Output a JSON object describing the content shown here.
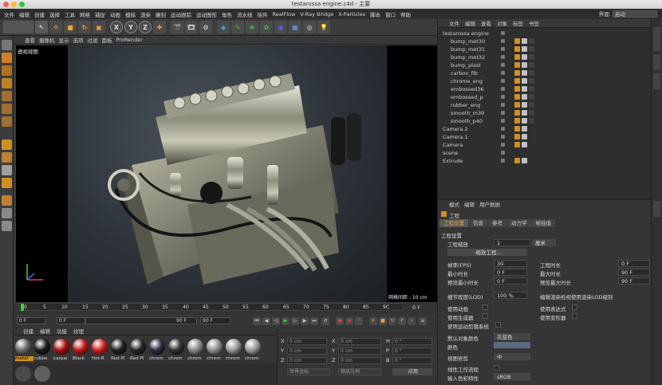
{
  "window": {
    "title": "testarossa engine.c4d - 主要"
  },
  "menu": [
    "文件",
    "编辑",
    "创建",
    "选择",
    "工具",
    "网格",
    "捕捉",
    "动画",
    "模拟",
    "渲染",
    "雕刻",
    "运动跟踪",
    "运动图形",
    "角色",
    "流水线",
    "插件",
    "RealFlow",
    "V-Ray Bridge",
    "X-Particles",
    "脚本",
    "窗口",
    "帮助"
  ],
  "layout": {
    "label": "界面:",
    "value": "启动"
  },
  "toolbar": {
    "x": "X",
    "y": "Y",
    "z": "Z"
  },
  "viewport": {
    "menu": [
      "查看",
      "摄像机",
      "显示",
      "选项",
      "过滤",
      "面板",
      "ProRender"
    ],
    "title": "透视视图",
    "grid_info": "网格间距 : 10 cm"
  },
  "timeline": {
    "ticks": [
      "0",
      "5",
      "10",
      "15",
      "20",
      "25",
      "30",
      "35",
      "40",
      "45",
      "50",
      "55",
      "60",
      "65",
      "70",
      "75",
      "80",
      "85",
      "9C"
    ],
    "end_label": "0 F"
  },
  "transport": {
    "current": "0 F",
    "start": "0 F",
    "end": "90 F",
    "end2": "90 F"
  },
  "materials": {
    "menu": [
      "创建",
      "编辑",
      "功能",
      "纹理"
    ],
    "items": [
      {
        "label": "metal",
        "color": "#6a6a6a"
      },
      {
        "label": "rubbe",
        "color": "#1a1a1a"
      },
      {
        "label": "carpai",
        "color": "#b01010"
      },
      {
        "label": "Black",
        "color": "#c01818"
      },
      {
        "label": "Hot-R",
        "color": "#d02020"
      },
      {
        "label": "Red Pl",
        "color": "#202020"
      },
      {
        "label": "Red Pl",
        "color": "#252525"
      },
      {
        "label": "chrom",
        "color": "#2a2a40"
      },
      {
        "label": "chrom",
        "color": "#303030"
      },
      {
        "label": "chrom",
        "color": "#8a8a8a"
      },
      {
        "label": "chrom",
        "color": "#909090"
      },
      {
        "label": "chrom",
        "color": "#959595"
      },
      {
        "label": "chrom",
        "color": "#9a9a9a"
      }
    ]
  },
  "coords": {
    "x": {
      "label": "X",
      "pos": "0 cm",
      "size": "0 cm",
      "rot_label": "H",
      "rot": "0 °"
    },
    "y": {
      "label": "Y",
      "pos": "0 cm",
      "size": "0 cm",
      "rot_label": "P",
      "rot": "0 °"
    },
    "z": {
      "label": "Z",
      "pos": "0 cm",
      "size": "0 cm",
      "rot_label": "B",
      "rot": "0 °"
    },
    "mode1": "世界坐标",
    "mode2": "缩放比例",
    "apply": "应用"
  },
  "objects": {
    "menu": [
      "文件",
      "编辑",
      "查看",
      "对象",
      "标签",
      "书签"
    ],
    "rows": [
      {
        "name": "testarossa engine",
        "indent": 0
      },
      {
        "name": "bump_met30",
        "indent": 2
      },
      {
        "name": "bump_met31",
        "indent": 2
      },
      {
        "name": "bump_met32",
        "indent": 2
      },
      {
        "name": "bump_plast",
        "indent": 2
      },
      {
        "name": "carbon_fib",
        "indent": 2
      },
      {
        "name": "chrome_eng",
        "indent": 2
      },
      {
        "name": "embossed36",
        "indent": 2
      },
      {
        "name": "embossed_p",
        "indent": 2
      },
      {
        "name": "rubber_eng",
        "indent": 2
      },
      {
        "name": "smooth_m39",
        "indent": 2
      },
      {
        "name": "smooth_p40",
        "indent": 2
      },
      {
        "name": "Camera.2",
        "indent": 0
      },
      {
        "name": "Camera.1",
        "indent": 0
      },
      {
        "name": "Camera",
        "indent": 0
      },
      {
        "name": "scene",
        "indent": 0
      },
      {
        "name": "Extrude",
        "indent": 0
      }
    ]
  },
  "attributes": {
    "menu": [
      "模式",
      "编辑",
      "用户数据"
    ],
    "header": "工程",
    "tabs": [
      "工程设置",
      "信息",
      "参考",
      "动力学",
      "帧插值"
    ],
    "section": "工程设置",
    "scale_label": "工程缩放",
    "scale_value": "1",
    "scale_unit": "厘米",
    "scale_button": "缩放工程...",
    "fps_label": "帧率(FPS)",
    "fps_value": "30",
    "project_time_label": "工程时长",
    "project_time_value": "0 F",
    "min_time_label": "最小时长",
    "min_time_value": "0 F",
    "max_time_label": "最大时长",
    "max_time_value": "90 F",
    "preview_min_label": "预览最小时长",
    "preview_min_value": "0 F",
    "preview_max_label": "预览最大时长",
    "preview_max_value": "90 F",
    "lod_label": "细节程度(LOD)",
    "lod_value": "100 %",
    "lod_render_label": "编辑渲染检视使用渲染LOD级别",
    "use_anim": "使用动画",
    "use_expr": "使用表达式",
    "use_gen": "使用生成器",
    "use_deform": "使用变形器",
    "use_motion": "使用运动剪辑系统",
    "default_color_label": "默认对象颜色",
    "default_color_value": "灰蓝色",
    "color_label": "颜色",
    "view_clip_label": "视图修剪",
    "view_clip_value": "中",
    "linear_label": "线性工作流程",
    "input_color_label": "输入色彩特性",
    "input_color_value": "sRGB"
  }
}
